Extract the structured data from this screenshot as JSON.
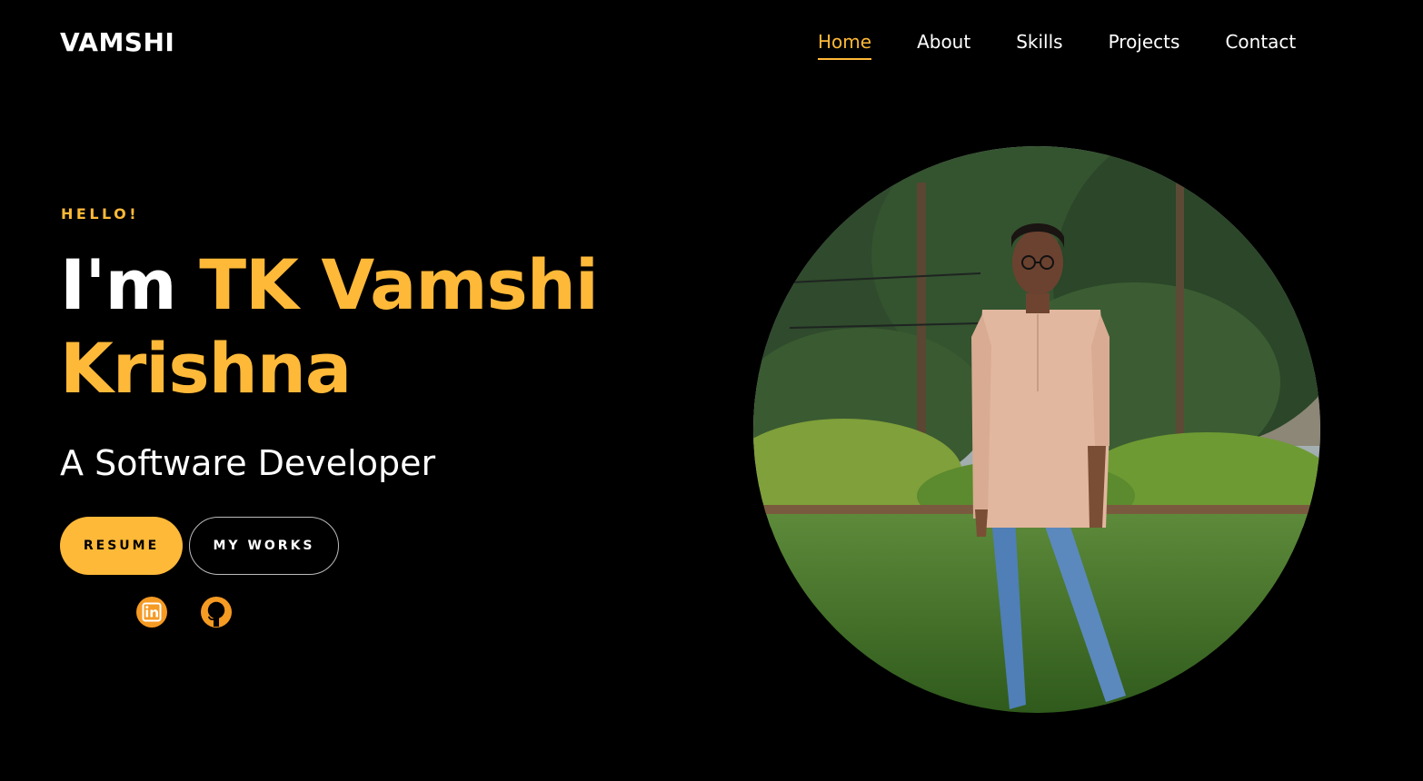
{
  "header": {
    "logo": "VAMSHI",
    "nav": [
      {
        "label": "Home",
        "active": true
      },
      {
        "label": "About",
        "active": false
      },
      {
        "label": "Skills",
        "active": false
      },
      {
        "label": "Projects",
        "active": false
      },
      {
        "label": "Contact",
        "active": false
      }
    ]
  },
  "hero": {
    "greeting": "HELLO!",
    "intro": "I'm",
    "name": "TK Vamshi Krishna",
    "subtitle": "A Software Developer",
    "buttons": {
      "resume": "RESUME",
      "works": "MY WORKS"
    },
    "social": [
      {
        "icon": "linkedin-icon"
      },
      {
        "icon": "github-icon"
      }
    ],
    "portrait": {
      "icon": "profile-photo"
    }
  },
  "colors": {
    "background": "#000000",
    "accent": "#ffb938",
    "social_icon": "#f59a23",
    "text": "#ffffff"
  }
}
